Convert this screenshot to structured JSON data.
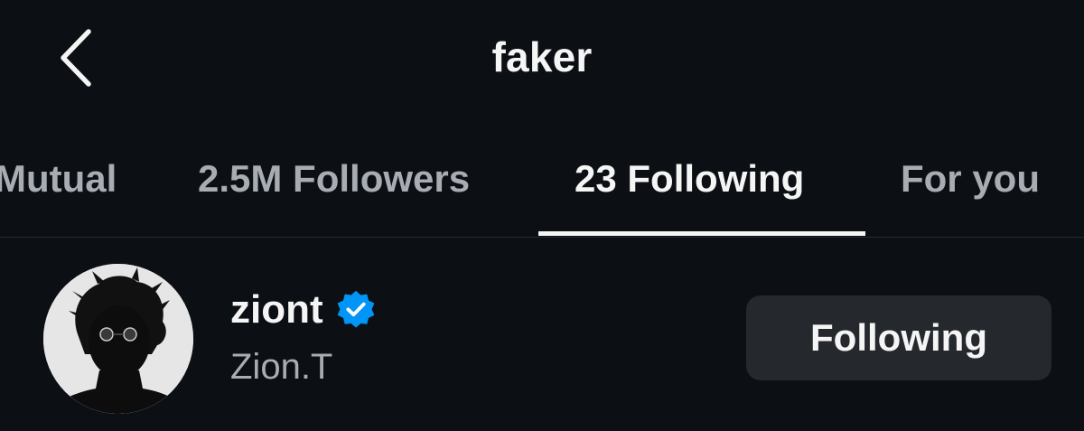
{
  "header": {
    "title": "faker",
    "back_icon": "chevron-left-icon"
  },
  "tabs": [
    {
      "label": "Mutual",
      "active": false
    },
    {
      "label": "2.5M Followers",
      "active": false
    },
    {
      "label": "23 Following",
      "active": true
    },
    {
      "label": "For you",
      "active": false
    }
  ],
  "users": [
    {
      "username": "ziont",
      "verified": true,
      "full_name": "Zion.T",
      "button_label": "Following"
    }
  ],
  "colors": {
    "background": "#0c1014",
    "text_primary": "#f5f5f5",
    "text_secondary": "#a8acb3",
    "button_bg": "#25292e",
    "verified_blue": "#0095f6"
  }
}
